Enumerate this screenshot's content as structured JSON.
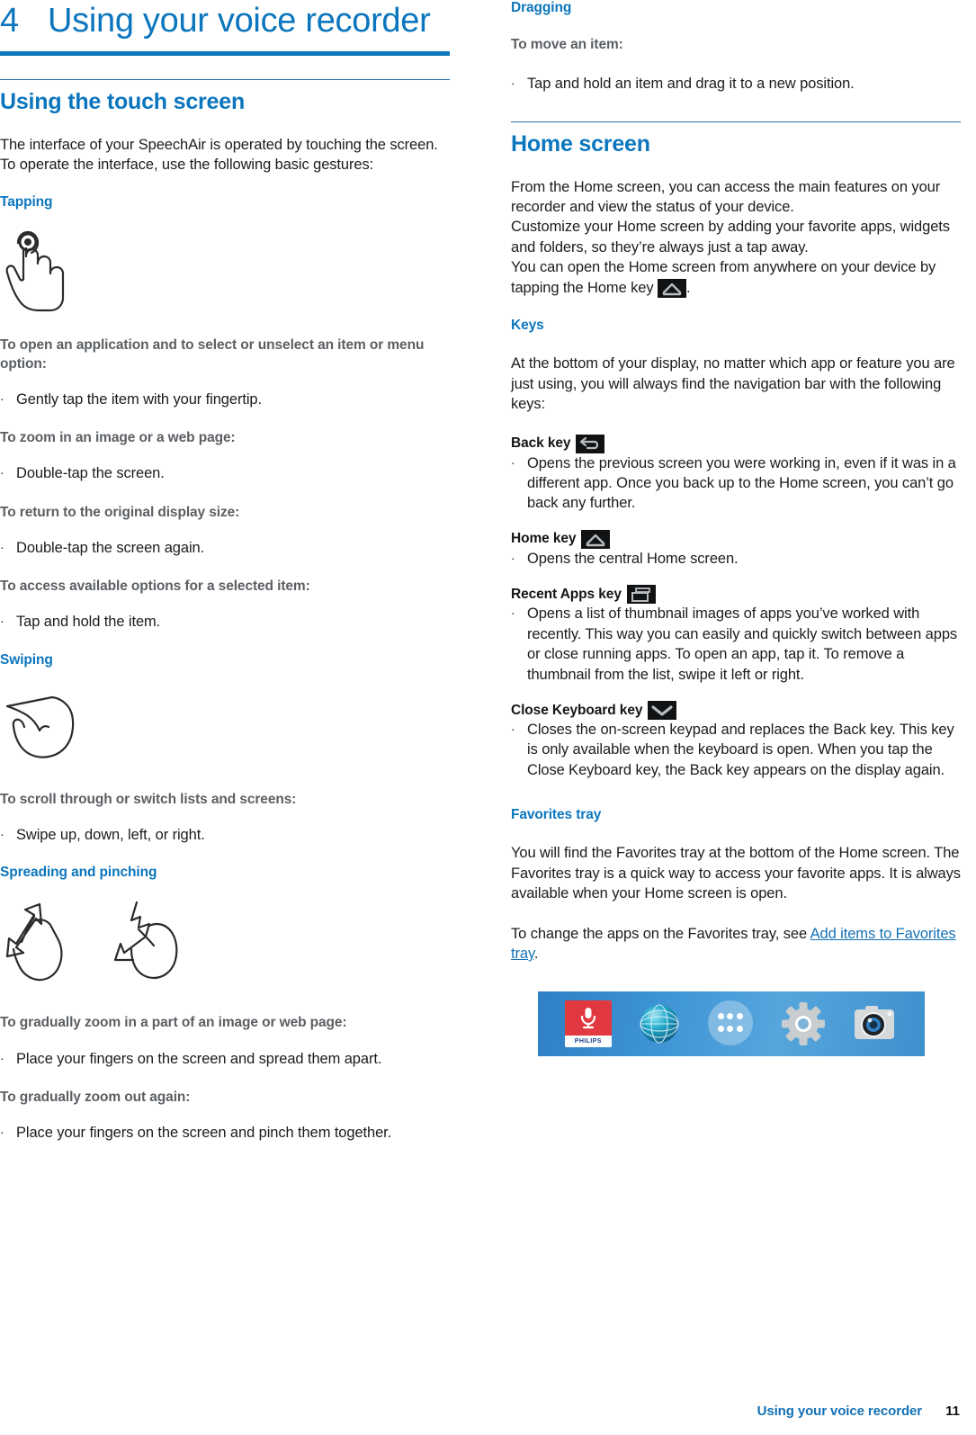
{
  "chapter": {
    "number": "4",
    "title": "Using your voice recorder"
  },
  "left": {
    "section_title": "Using the touch screen",
    "intro": "The interface of your SpeechAir is operated by touching the screen. To operate the interface, use the following basic gestures:",
    "tapping": {
      "heading": "Tapping",
      "illustration": "tap-hand-illustration",
      "tasks": [
        {
          "label": "To open an application and to select or unselect an item or menu option:",
          "bullets": [
            "Gently tap the item with your fingertip."
          ]
        },
        {
          "label": "To zoom in an image or a web page:",
          "bullets": [
            "Double-tap the screen."
          ]
        },
        {
          "label": "To return to the original display size:",
          "bullets": [
            "Double-tap the screen again."
          ]
        },
        {
          "label": "To access available options for a selected item:",
          "bullets": [
            "Tap and hold the item."
          ]
        }
      ]
    },
    "swiping": {
      "heading": "Swiping",
      "illustration": "swipe-hand-illustration",
      "tasks": [
        {
          "label": "To scroll through or switch lists and screens:",
          "bullets": [
            "Swipe up, down, left, or right."
          ]
        }
      ]
    },
    "spreading": {
      "heading": "Spreading and pinching",
      "illustration_spread": "spread-hand-illustration",
      "illustration_pinch": "pinch-hand-illustration",
      "tasks": [
        {
          "label": "To gradually zoom in a part of an image or web page:",
          "bullets": [
            "Place your fingers on the screen and spread them apart."
          ]
        },
        {
          "label": "To gradually zoom out again:",
          "bullets": [
            "Place your fingers on the screen and pinch them together."
          ]
        }
      ]
    }
  },
  "right": {
    "dragging": {
      "heading": "Dragging",
      "tasks": [
        {
          "label": "To move an item:",
          "bullets": [
            "Tap and hold an item and drag it to a new position."
          ]
        }
      ]
    },
    "home_screen": {
      "section_title": "Home screen",
      "paragraphs": [
        "From the Home screen, you can access the main features on your recorder and view the status of your device.",
        "Customize your Home screen by adding your favorite apps, widgets and folders, so they’re always just a tap away."
      ],
      "home_key_sentence_before": "You can open the Home screen from anywhere on your device by tapping the Home key",
      "home_key_sentence_after": "."
    },
    "keys": {
      "heading": "Keys",
      "intro": "At the bottom of your display, no matter which app or feature you are just using, you will always find the navigation bar with the following keys:",
      "items": [
        {
          "label": "Back key",
          "icon": "back-arrow-icon",
          "bullets": [
            "Opens the previous screen you were working in, even if it was in a different app. Once you back up to the Home screen, you can’t go back any further."
          ]
        },
        {
          "label": "Home key",
          "icon": "home-house-icon",
          "bullets": [
            "Opens the central Home screen."
          ]
        },
        {
          "label": "Recent Apps key",
          "icon": "recent-apps-icon",
          "bullets": [
            "Opens a list of thumbnail images of apps you’ve worked with recently. This way you can easily and quickly switch between apps or close running apps. To open an app, tap it. To remove a thumbnail from the list, swipe it left or right."
          ]
        },
        {
          "label": "Close Keyboard key",
          "icon": "chevron-down-icon",
          "bullets": [
            "Closes the on-screen keypad and replaces the Back key. This key is only available when the keyboard is open. When you tap the Close Keyboard key, the Back key appears on the display again."
          ]
        }
      ]
    },
    "favorites": {
      "heading": "Favorites tray",
      "paragraph": "You will find the Favorites tray at the bottom of the Home screen. The Favorites tray is a quick way to access your favorite apps. It is always available when your Home screen is open.",
      "link_sentence_before": "To change the apps on the Favorites tray, see",
      "link_text": "Add items to Favorites tray",
      "link_sentence_after": ".",
      "tray_image": {
        "label": "favorites-tray-screenshot",
        "apps": [
          {
            "name": "philips-voice-recorder-icon",
            "label": "PHILIPS"
          },
          {
            "name": "browser-globe-icon",
            "label": ""
          },
          {
            "name": "app-drawer-icon",
            "label": ""
          },
          {
            "name": "settings-gear-icon",
            "label": ""
          },
          {
            "name": "camera-icon",
            "label": ""
          }
        ]
      }
    }
  },
  "footer": {
    "text": "Using your voice recorder",
    "page": "11"
  },
  "colors": {
    "brand_blue": "#0b76bd",
    "heading_gray": "#5b5f63",
    "body_black": "#1c1c1c",
    "link_blue": "#1471b5"
  }
}
